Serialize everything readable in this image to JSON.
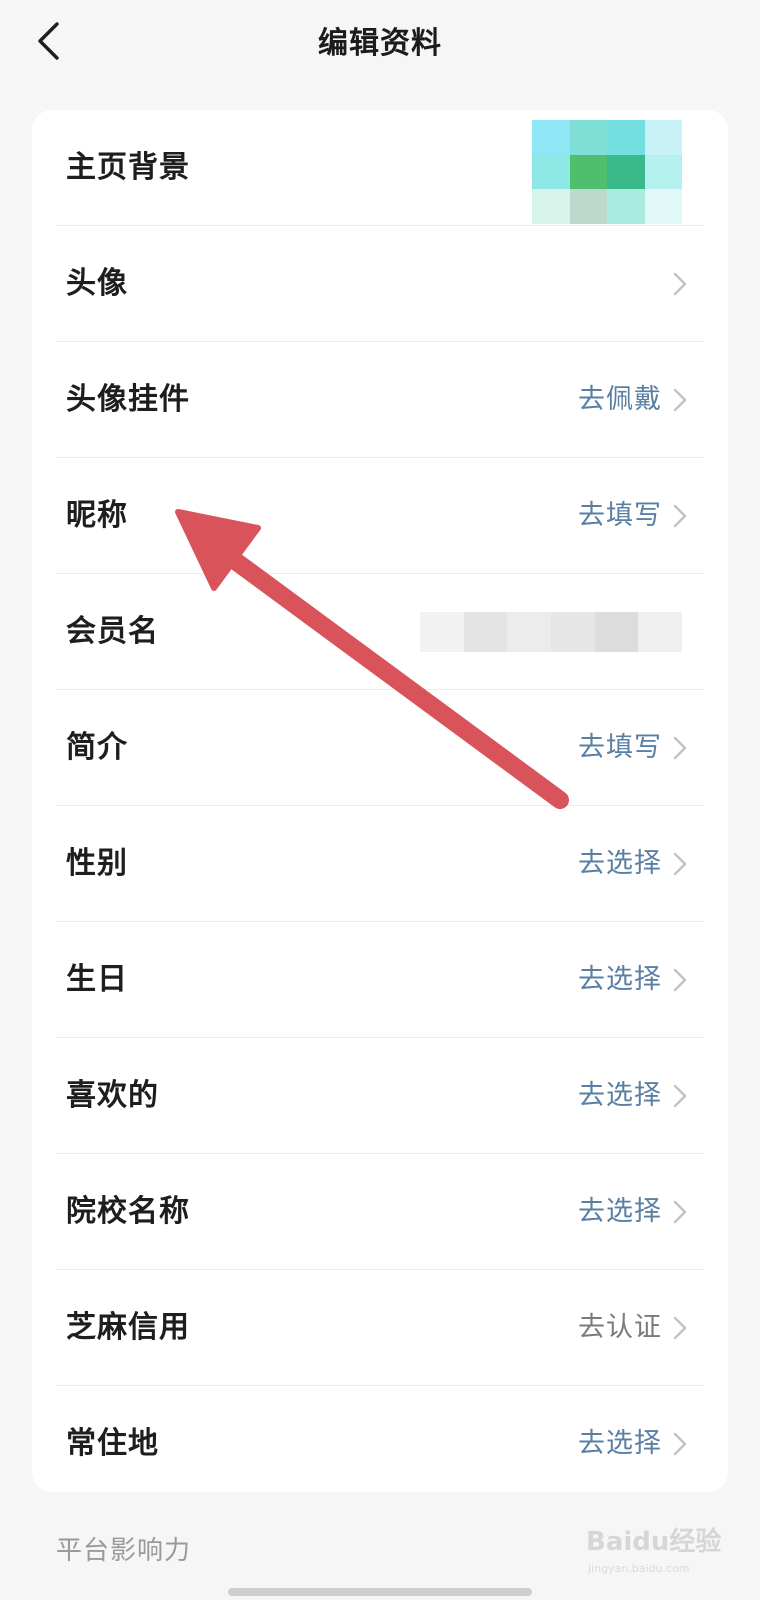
{
  "header": {
    "title": "编辑资料"
  },
  "rows": [
    {
      "label": "主页背景",
      "value": ""
    },
    {
      "label": "头像",
      "value": ""
    },
    {
      "label": "头像挂件",
      "value": "去佩戴"
    },
    {
      "label": "昵称",
      "value": "去填写"
    },
    {
      "label": "会员名",
      "value": ""
    },
    {
      "label": "简介",
      "value": "去填写"
    },
    {
      "label": "性别",
      "value": "去选择"
    },
    {
      "label": "生日",
      "value": "去选择"
    },
    {
      "label": "喜欢的",
      "value": "去选择"
    },
    {
      "label": "院校名称",
      "value": "去选择"
    },
    {
      "label": "芝麻信用",
      "value": "去认证"
    },
    {
      "label": "常住地",
      "value": "去选择"
    }
  ],
  "section": {
    "label": "平台影响力"
  },
  "watermark": {
    "text": "Baidu经验",
    "subtext": "jingyan.baidu.com"
  },
  "colors": {
    "accent_link": "#5a7fa3",
    "muted_link": "#7a7a7a",
    "annotation_arrow": "#d9535a"
  },
  "mosaic_colors": [
    "#8fe6f5",
    "#7fdfd6",
    "#74dfe0",
    "#c9f2f8",
    "#8ee8e6",
    "#4fbf6d",
    "#3ab98a",
    "#b4f0ee",
    "#d6f4ea",
    "#bcd9cb",
    "#a9ecdf",
    "#e0f8f8"
  ],
  "blur_colors": [
    "#f2f2f2",
    "#e4e4e4",
    "#ececec",
    "#e6e6e6",
    "#dcdcdc",
    "#efefef"
  ]
}
